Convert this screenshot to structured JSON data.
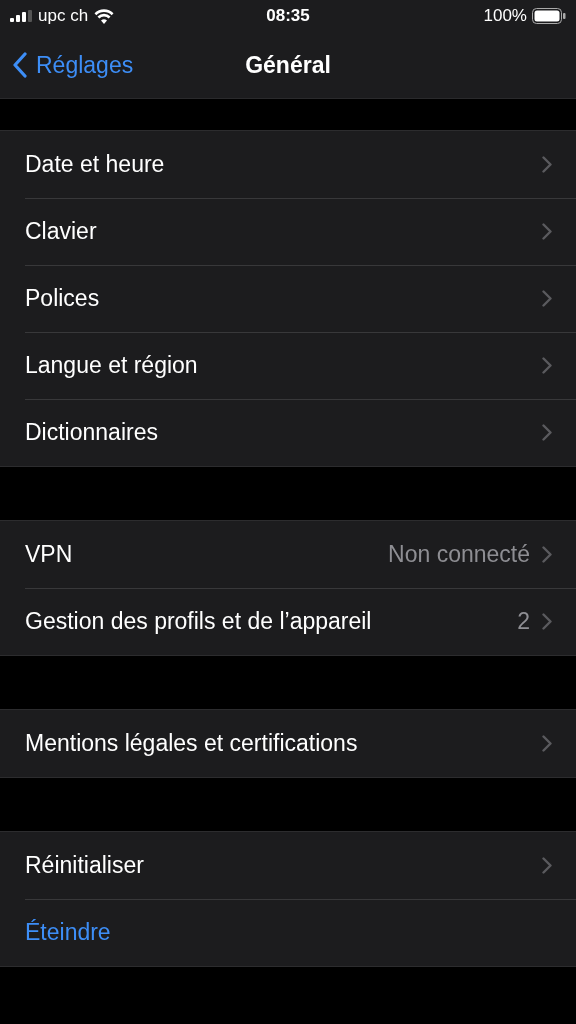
{
  "status_bar": {
    "carrier": "upc ch",
    "time": "08:35",
    "battery": "100%"
  },
  "nav": {
    "back": "Réglages",
    "title": "Général"
  },
  "groups": [
    {
      "rows": [
        {
          "kind": "link",
          "label": "Date et heure"
        },
        {
          "kind": "link",
          "label": "Clavier"
        },
        {
          "kind": "link",
          "label": "Polices"
        },
        {
          "kind": "link",
          "label": "Langue et région"
        },
        {
          "kind": "link",
          "label": "Dictionnaires"
        }
      ]
    },
    {
      "rows": [
        {
          "kind": "link",
          "label": "VPN",
          "value": "Non connecté"
        },
        {
          "kind": "link",
          "label": "Gestion des profils et de l’appareil",
          "value": "2"
        }
      ]
    },
    {
      "rows": [
        {
          "kind": "link",
          "label": "Mentions légales et certifications"
        }
      ]
    },
    {
      "rows": [
        {
          "kind": "link",
          "label": "Réinitialiser"
        },
        {
          "kind": "action",
          "label": "Éteindre"
        }
      ]
    }
  ]
}
